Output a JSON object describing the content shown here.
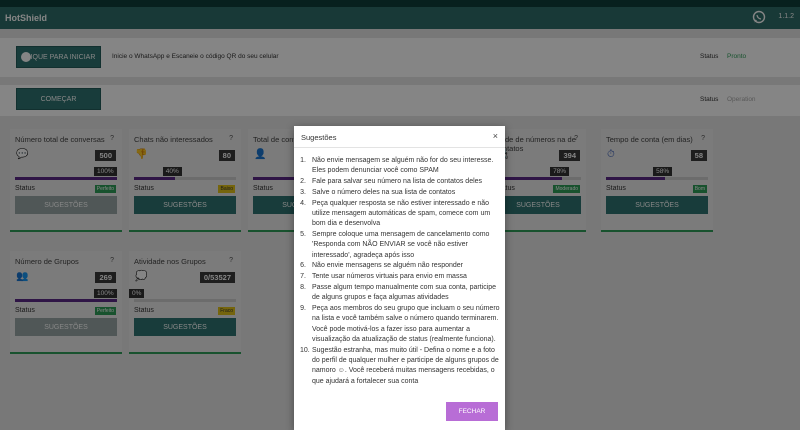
{
  "app": {
    "title": "HotShield",
    "version": "1.1.2"
  },
  "start_bar": {
    "button_label": "CLIQUE PARA INICIAR",
    "instruction": "Inicie o WhatsApp e Escaneie o código QR do seu celular",
    "status_label": "Status",
    "status_value": "Pronto"
  },
  "begin_bar": {
    "button_label": "COMEÇAR",
    "status_label": "Status",
    "status_value": "Operation"
  },
  "cards": [
    {
      "title": "Número total de conversas",
      "value": "500",
      "percent_label": "100%",
      "progress": 1.0,
      "status_label": "Status",
      "badge": "Perfeito",
      "badge_color": "#2e9e58",
      "button": "SUGESTÕES",
      "disabled": true
    },
    {
      "title": "Chats não interessados",
      "value": "80",
      "percent_label": "40%",
      "progress": 0.4,
      "status_label": "Status",
      "badge": "Baixo",
      "badge_color": "#e0c21a",
      "button": "SUGESTÕES",
      "disabled": false
    },
    {
      "title": "Total de conta",
      "value": "",
      "percent_label": "",
      "progress": 0.5,
      "status_label": "Status",
      "badge": "",
      "badge_color": "#2e9e58",
      "button": "SUGESTÕES",
      "disabled": false
    },
    {
      "title": "idade de números na de contatos",
      "value": "394",
      "percent_label": "78%",
      "progress": 0.78,
      "status_label": "Status",
      "badge": "Moderado",
      "badge_color": "#2e9e58",
      "button": "SUGESTÕES",
      "disabled": false
    },
    {
      "title": "Tempo de conta (em dias)",
      "value": "58",
      "percent_label": "58%",
      "progress": 0.58,
      "status_label": "Status",
      "badge": "Bom",
      "badge_color": "#2e9e58",
      "button": "SUGESTÕES",
      "disabled": false
    },
    {
      "title": "Número de Grupos",
      "value": "269",
      "percent_label": "100%",
      "progress": 1.0,
      "status_label": "Status",
      "badge": "Perfeito",
      "badge_color": "#2e9e58",
      "button": "SUGESTÕES",
      "disabled": true
    },
    {
      "title": "Atividade nos Grupos",
      "value": "0/53527",
      "percent_label": "0%",
      "progress": 0.0,
      "status_label": "Status",
      "badge": "Fraco",
      "badge_color": "#e0c21a",
      "button": "SUGESTÕES",
      "disabled": false
    }
  ],
  "modal": {
    "title": "Sugestões",
    "close": "×",
    "items": [
      "Não envie mensagem se alguém não for do seu interesse. Eles podem denunciar você como SPAM",
      "Fale para salvar seu número na lista de contatos deles",
      "Salve o número deles na sua lista de contatos",
      "Peça qualquer resposta se não estiver interessado e não utilize mensagem automáticas de spam, comece com um bom dia e desenvolva",
      "Sempre coloque uma mensagem de cancelamento como 'Responda com NÃO ENVIAR se você não estiver interessado', agradeça após isso",
      "Não envie mensagens se alguém não responder",
      "Tente usar números virtuais para envio em massa",
      "Passe algum tempo manualmente com sua conta, participe de alguns grupos e faça algumas atividades",
      "Peça aos membros do seu grupo que incluam o seu número na lista e você também salve o número quando terminarem. Você pode motivá-los a fazer isso para aumentar a visualização da atualização de status (realmente funciona).",
      "Sugestão estranha, mas muito útil - Defina o nome e a foto do perfil de qualquer mulher e participe de alguns grupos de namoro ☺. Você receberá muitas mensagens recebidas, o que ajudará a fortalecer sua conta"
    ],
    "button_label": "FECHAR"
  }
}
